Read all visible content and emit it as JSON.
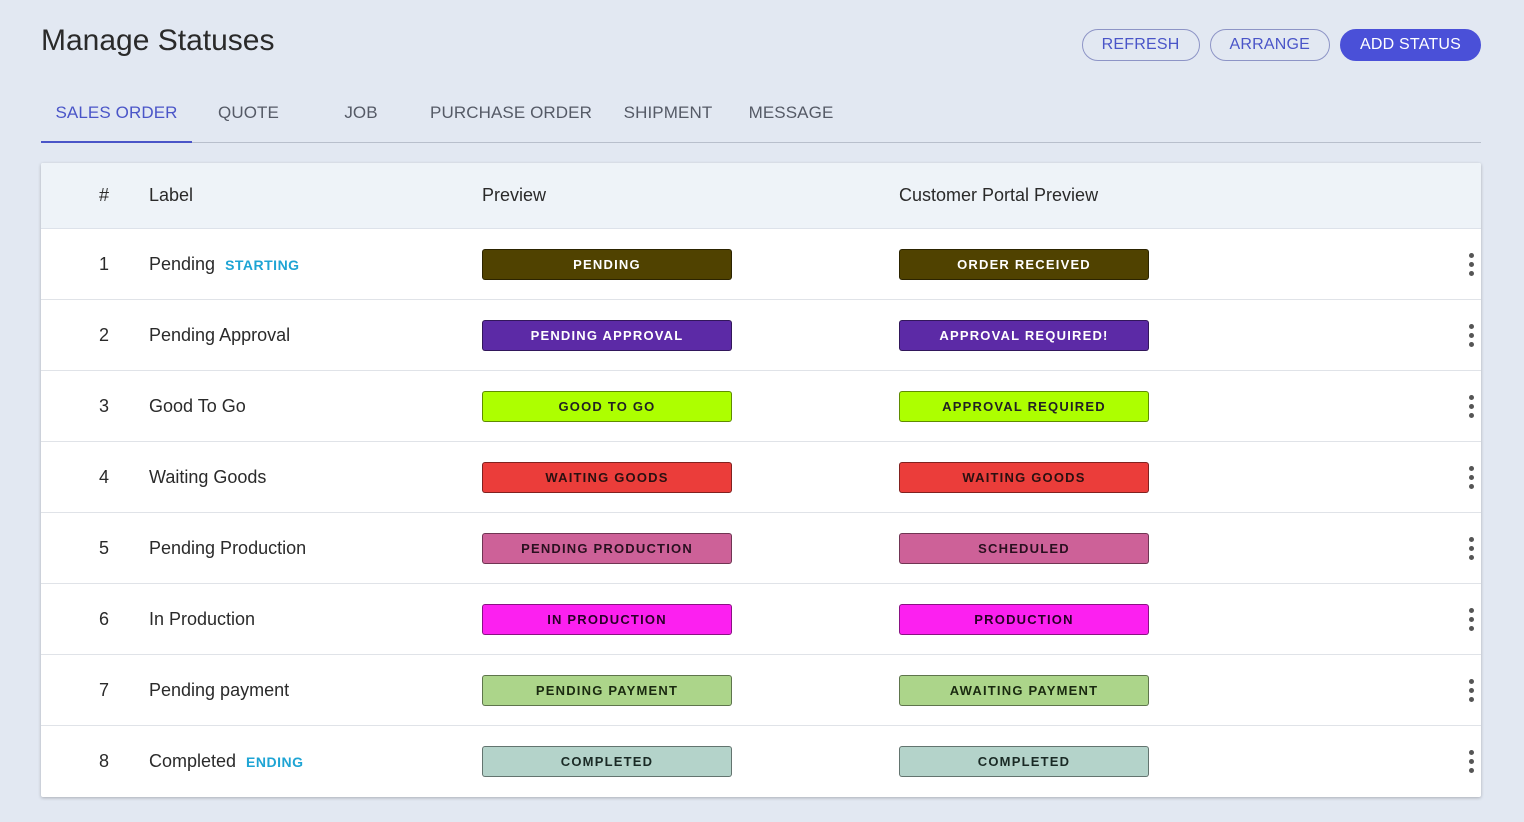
{
  "page": {
    "title": "Manage Statuses"
  },
  "actions": {
    "refresh": "REFRESH",
    "arrange": "ARRANGE",
    "add": "ADD STATUS"
  },
  "tabs": [
    {
      "label": "SALES ORDER",
      "active": true
    },
    {
      "label": "QUOTE"
    },
    {
      "label": "JOB"
    },
    {
      "label": "PURCHASE ORDER"
    },
    {
      "label": "SHIPMENT"
    },
    {
      "label": "MESSAGE"
    }
  ],
  "table": {
    "headers": {
      "num": "#",
      "label": "Label",
      "preview": "Preview",
      "portal": "Customer Portal Preview"
    },
    "rows": [
      {
        "num": "1",
        "label": "Pending",
        "tag": "STARTING",
        "preview": "PENDING",
        "portal": "ORDER RECEIVED",
        "bg": "#504200",
        "fg": "#ffffff"
      },
      {
        "num": "2",
        "label": "Pending Approval",
        "tag": "",
        "preview": "PENDING APPROVAL",
        "portal": "APPROVAL REQUIRED!",
        "bg": "#5c2aa6",
        "fg": "#ffffff"
      },
      {
        "num": "3",
        "label": "Good To Go",
        "tag": "",
        "preview": "GOOD TO GO",
        "portal": "APPROVAL REQUIRED",
        "bg": "#adff00",
        "fg": "#222222"
      },
      {
        "num": "4",
        "label": "Waiting Goods",
        "tag": "",
        "preview": "WAITING GOODS",
        "portal": "WAITING GOODS",
        "bg": "#eb3d3a",
        "fg": "#2a1010"
      },
      {
        "num": "5",
        "label": "Pending Production",
        "tag": "",
        "preview": "PENDING PRODUCTION",
        "portal": "SCHEDULED",
        "bg": "#cd6198",
        "fg": "#2a1020"
      },
      {
        "num": "6",
        "label": "In Production",
        "tag": "",
        "preview": "IN PRODUCTION",
        "portal": "PRODUCTION",
        "bg": "#fc20f0",
        "fg": "#2a0028"
      },
      {
        "num": "7",
        "label": "Pending payment",
        "tag": "",
        "preview": "PENDING PAYMENT",
        "portal": "AWAITING PAYMENT",
        "bg": "#acd58a",
        "fg": "#1a2a10"
      },
      {
        "num": "8",
        "label": "Completed",
        "tag": "ENDING",
        "preview": "COMPLETED",
        "portal": "COMPLETED",
        "bg": "#b4d3ca",
        "fg": "#1a2a25"
      }
    ]
  }
}
